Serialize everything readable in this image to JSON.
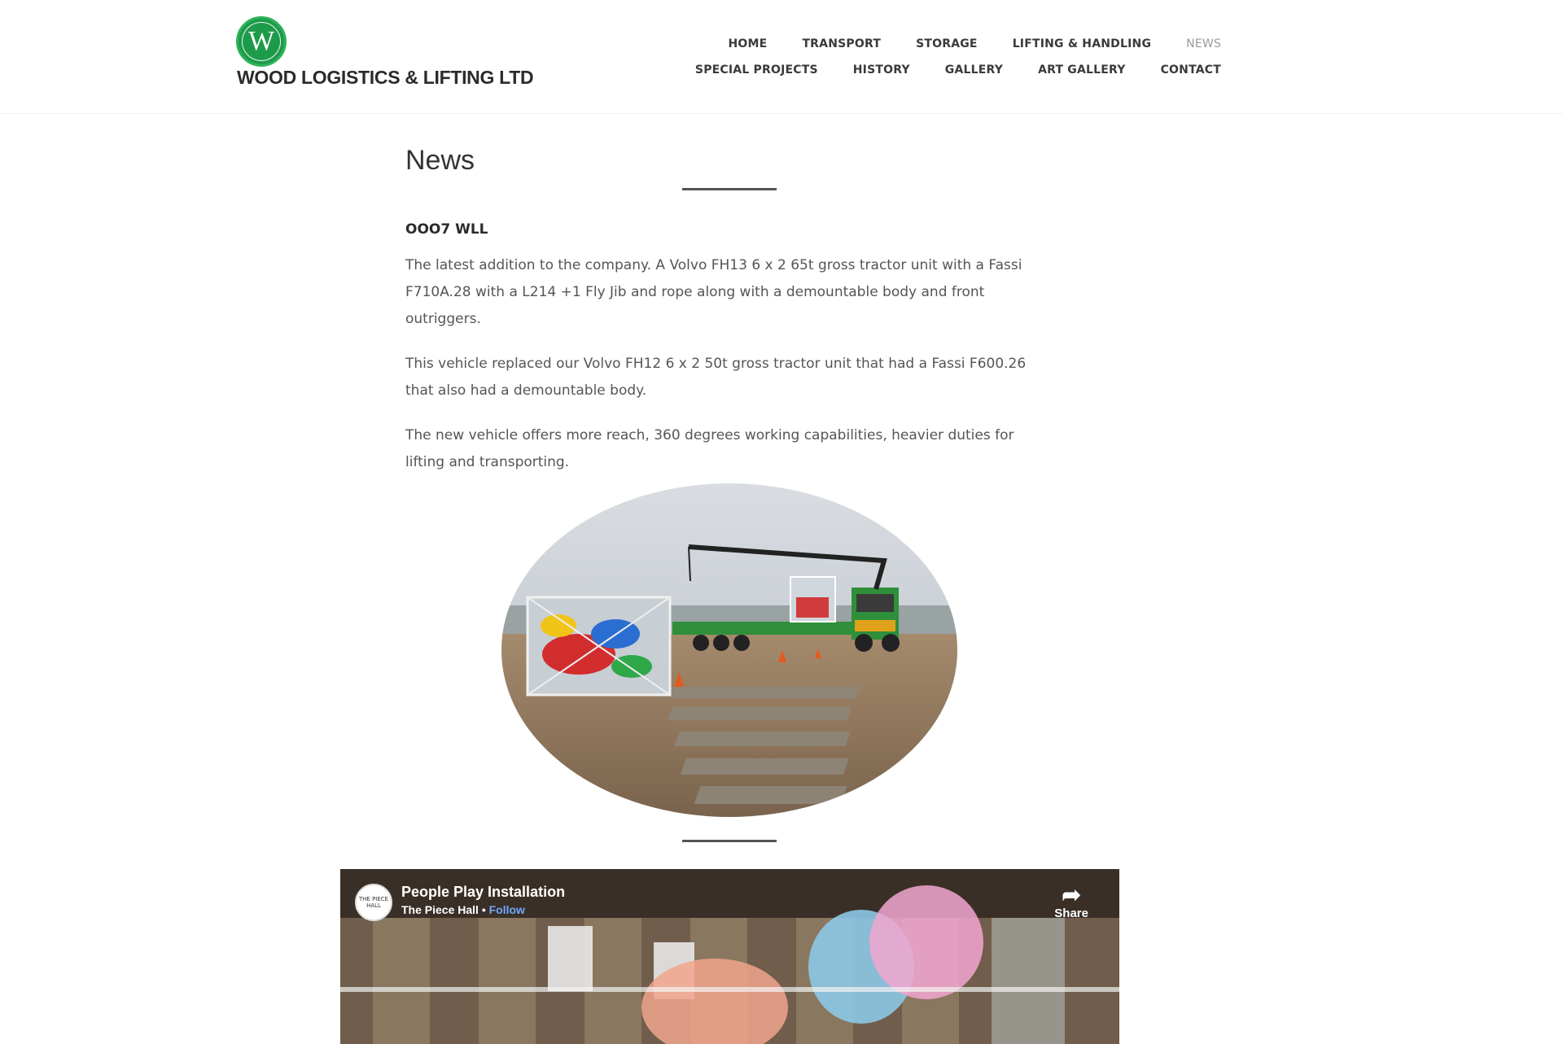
{
  "brand": {
    "logo_letter": "W",
    "company_name": "WOOD LOGISTICS & LIFTING LTD",
    "accent_color": "#1e9b4a"
  },
  "nav": {
    "row1": [
      {
        "label": "HOME",
        "active": false
      },
      {
        "label": "TRANSPORT",
        "active": false
      },
      {
        "label": "STORAGE",
        "active": false
      },
      {
        "label": "LIFTING & HANDLING",
        "active": false
      },
      {
        "label": "NEWS",
        "active": true
      }
    ],
    "row2": [
      {
        "label": "SPECIAL PROJECTS",
        "active": false
      },
      {
        "label": "HISTORY",
        "active": false
      },
      {
        "label": "GALLERY",
        "active": false
      },
      {
        "label": "ART GALLERY",
        "active": false
      },
      {
        "label": "CONTACT",
        "active": false
      }
    ]
  },
  "page": {
    "title": "News",
    "post_title": "OOO7 WLL",
    "paragraphs": [
      "The latest addition to the company. A Volvo FH13 6 x 2 65t gross tractor unit with a Fassi F710A.28 with a L214 +1 Fly Jib and rope along with a demountable body and front outriggers.",
      "This vehicle replaced our Volvo FH12 6 x 2 50t gross tractor unit that had a Fassi F600.26 that also had a demountable body.",
      "The new vehicle offers more reach, 360 degrees working capabilities, heavier duties for lifting and transporting."
    ]
  },
  "video": {
    "avatar_text": "THE PIECE HALL",
    "title": "People Play Installation",
    "channel": "The Piece Hall",
    "separator": " • ",
    "follow_label": "Follow",
    "share_label": "Share",
    "share_icon": "share-arrow-icon"
  }
}
